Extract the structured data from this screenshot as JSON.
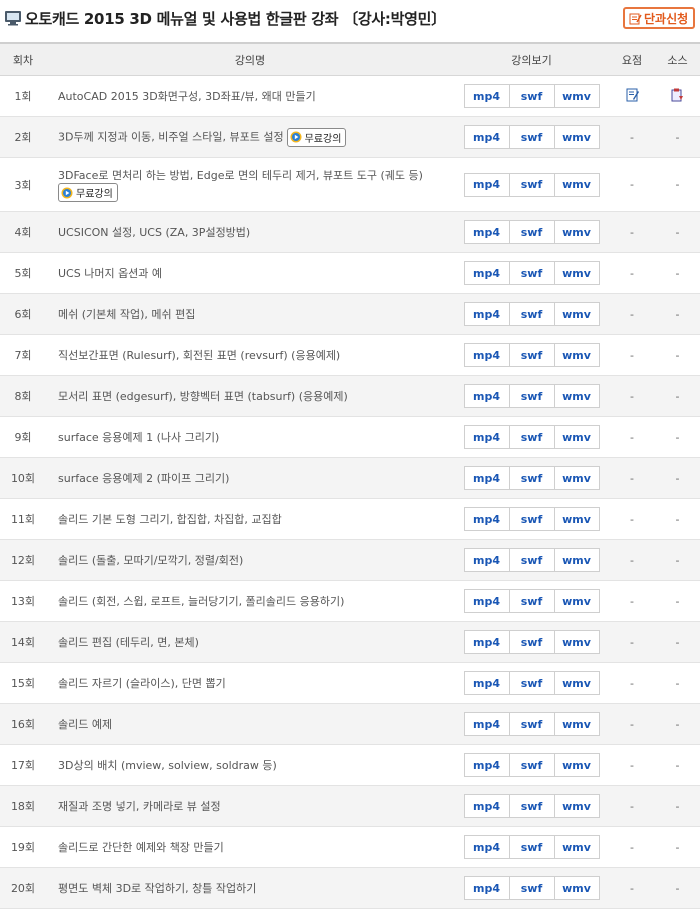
{
  "header": {
    "title": "오토캐드 2015 3D 메뉴얼 및 사용법 한글판 강좌 〔강사:박영민〕",
    "apply_button": "단과신청"
  },
  "table": {
    "columns": [
      "회차",
      "강의명",
      "강의보기",
      "요점",
      "소스"
    ],
    "formats": [
      "mp4",
      "swf",
      "wmv"
    ],
    "free_badge": "무료강의",
    "dash": "-",
    "rows": [
      {
        "num": "1회",
        "title": "AutoCAD 2015 3D화면구성, 3D좌표/뷰, 왜대 만들기",
        "summary": "memo-icon",
        "source": "download-icon"
      },
      {
        "num": "2회",
        "title": "3D두께 지정과 이동, 비주얼 스타일, 뷰포트 설정",
        "free": true
      },
      {
        "num": "3회",
        "title": "3DFace로 면처리 하는 방법, Edge로 면의 테두리 제거, 뷰포트 도구 (궤도 등)",
        "free": true,
        "tall": true
      },
      {
        "num": "4회",
        "title": "UCSICON 설정, UCS (ZA, 3P설정방법)"
      },
      {
        "num": "5회",
        "title": "UCS 나머지 옵션과 예"
      },
      {
        "num": "6회",
        "title": "메쉬 (기본체 작업), 메쉬 편집"
      },
      {
        "num": "7회",
        "title": "직선보간표면 (Rulesurf), 회전된 표면 (revsurf) (응용예제)"
      },
      {
        "num": "8회",
        "title": "모서리 표면 (edgesurf), 방향벡터 표면 (tabsurf) (응용예제)"
      },
      {
        "num": "9회",
        "title": "surface 응용예제 1 (나사 그리기)"
      },
      {
        "num": "10회",
        "title": "surface 응용예제 2 (파이프 그리기)"
      },
      {
        "num": "11회",
        "title": "솔리드 기본 도형 그리기, 합집합, 차집합, 교집합"
      },
      {
        "num": "12회",
        "title": "솔리드 (돌출, 모따기/모깍기, 정렬/회전)"
      },
      {
        "num": "13회",
        "title": "솔리드 (회전, 스윕, 로프트, 늘러당기기, 폴리솔리드 응용하기)"
      },
      {
        "num": "14회",
        "title": "솔리드 편집 (테두리, 면, 본체)"
      },
      {
        "num": "15회",
        "title": "솔리드 자르기 (슬라이스), 단면 뽑기"
      },
      {
        "num": "16회",
        "title": "솔리드 예제"
      },
      {
        "num": "17회",
        "title": "3D상의 배치 (mview, solview, soldraw 등)"
      },
      {
        "num": "18회",
        "title": "재질과 조명 넣기, 카메라로 뷰 설정"
      },
      {
        "num": "19회",
        "title": "솔리드로 간단한 예제와 책장 만들기"
      },
      {
        "num": "20회",
        "title": "평면도 벽체 3D로 작업하기, 창틀 작업하기"
      }
    ]
  }
}
